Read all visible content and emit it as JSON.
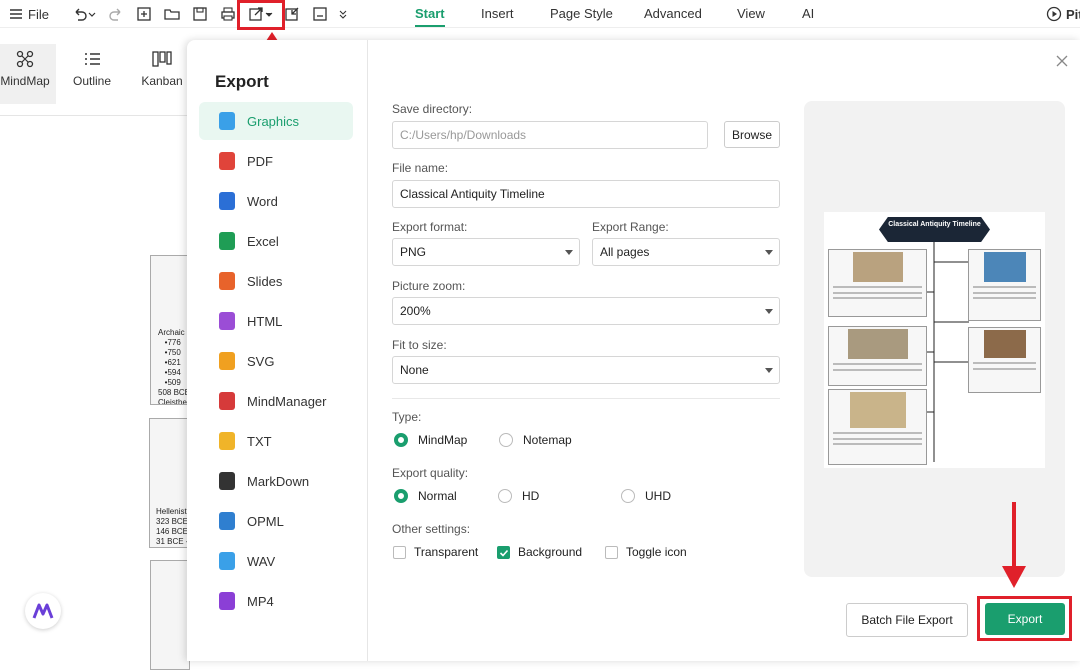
{
  "toolbar": {
    "file_label": "File",
    "tabs": [
      "Start",
      "Insert",
      "Page Style",
      "Advanced",
      "View",
      "AI"
    ],
    "play_label": "Pit"
  },
  "views": [
    "MindMap",
    "Outline",
    "Kanban"
  ],
  "canvas_nodes": {
    "archaic": "Archaic\n   •776\n   •750\n   •621\n   •594\n   •509\n508 BCE\nCleisthe",
    "hellenistic": "Hellenist\n323 BCE\n146 BCE\n31 BCE -"
  },
  "dialog": {
    "title": "Export",
    "formats": [
      "Graphics",
      "PDF",
      "Word",
      "Excel",
      "Slides",
      "HTML",
      "SVG",
      "MindManager",
      "TXT",
      "MarkDown",
      "OPML",
      "WAV",
      "MP4"
    ],
    "selected_format": "Graphics",
    "save_directory_label": "Save directory:",
    "save_directory_placeholder": "C:/Users/hp/Downloads",
    "browse_label": "Browse",
    "file_name_label": "File name:",
    "file_name_value": "Classical Antiquity Timeline",
    "export_format_label": "Export format:",
    "export_format_value": "PNG",
    "export_range_label": "Export Range:",
    "export_range_value": "All pages",
    "picture_zoom_label": "Picture zoom:",
    "picture_zoom_value": "200%",
    "fit_to_size_label": "Fit to size:",
    "fit_to_size_value": "None",
    "type_label": "Type:",
    "type_options": [
      "MindMap",
      "Notemap"
    ],
    "type_selected": "MindMap",
    "quality_label": "Export quality:",
    "quality_options": [
      "Normal",
      "HD",
      "UHD"
    ],
    "quality_selected": "Normal",
    "other_label": "Other settings:",
    "other_options": [
      {
        "label": "Transparent",
        "checked": false
      },
      {
        "label": "Background",
        "checked": true
      },
      {
        "label": "Toggle icon",
        "checked": false
      }
    ],
    "batch_label": "Batch File Export",
    "export_label": "Export"
  },
  "preview": {
    "title": "Classical Antiquity Timeline"
  },
  "colors": {
    "accent": "#1a9e6e",
    "highlight": "#e0202a",
    "selected_bg": "#e9f7f1"
  }
}
